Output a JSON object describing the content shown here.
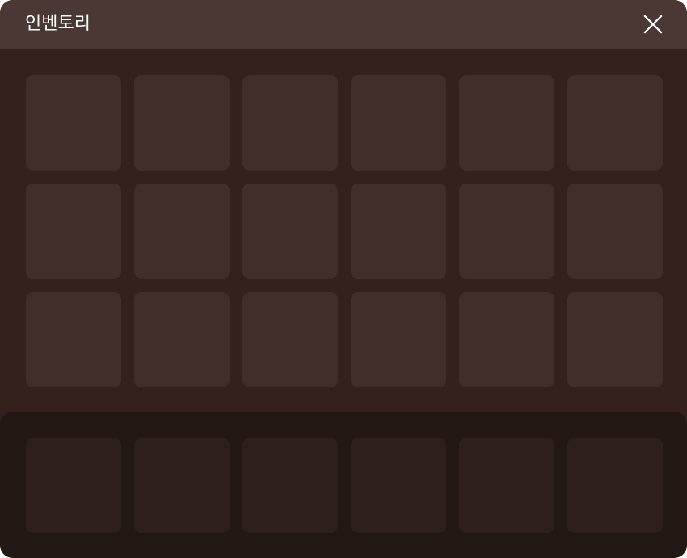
{
  "window": {
    "title": "인벤토리",
    "close_icon": "close-icon"
  },
  "inventory": {
    "rows": 3,
    "columns": 6,
    "slots": [
      "",
      "",
      "",
      "",
      "",
      "",
      "",
      "",
      "",
      "",
      "",
      "",
      "",
      "",
      "",
      "",
      "",
      ""
    ]
  },
  "hotbar": {
    "slots": [
      "",
      "",
      "",
      "",
      "",
      ""
    ]
  },
  "colors": {
    "panel": "#35211c",
    "titlebar": "#493833",
    "slot": "#412e28",
    "hotbar": "#241814",
    "hotbar_slot": "#2d1f1b"
  }
}
